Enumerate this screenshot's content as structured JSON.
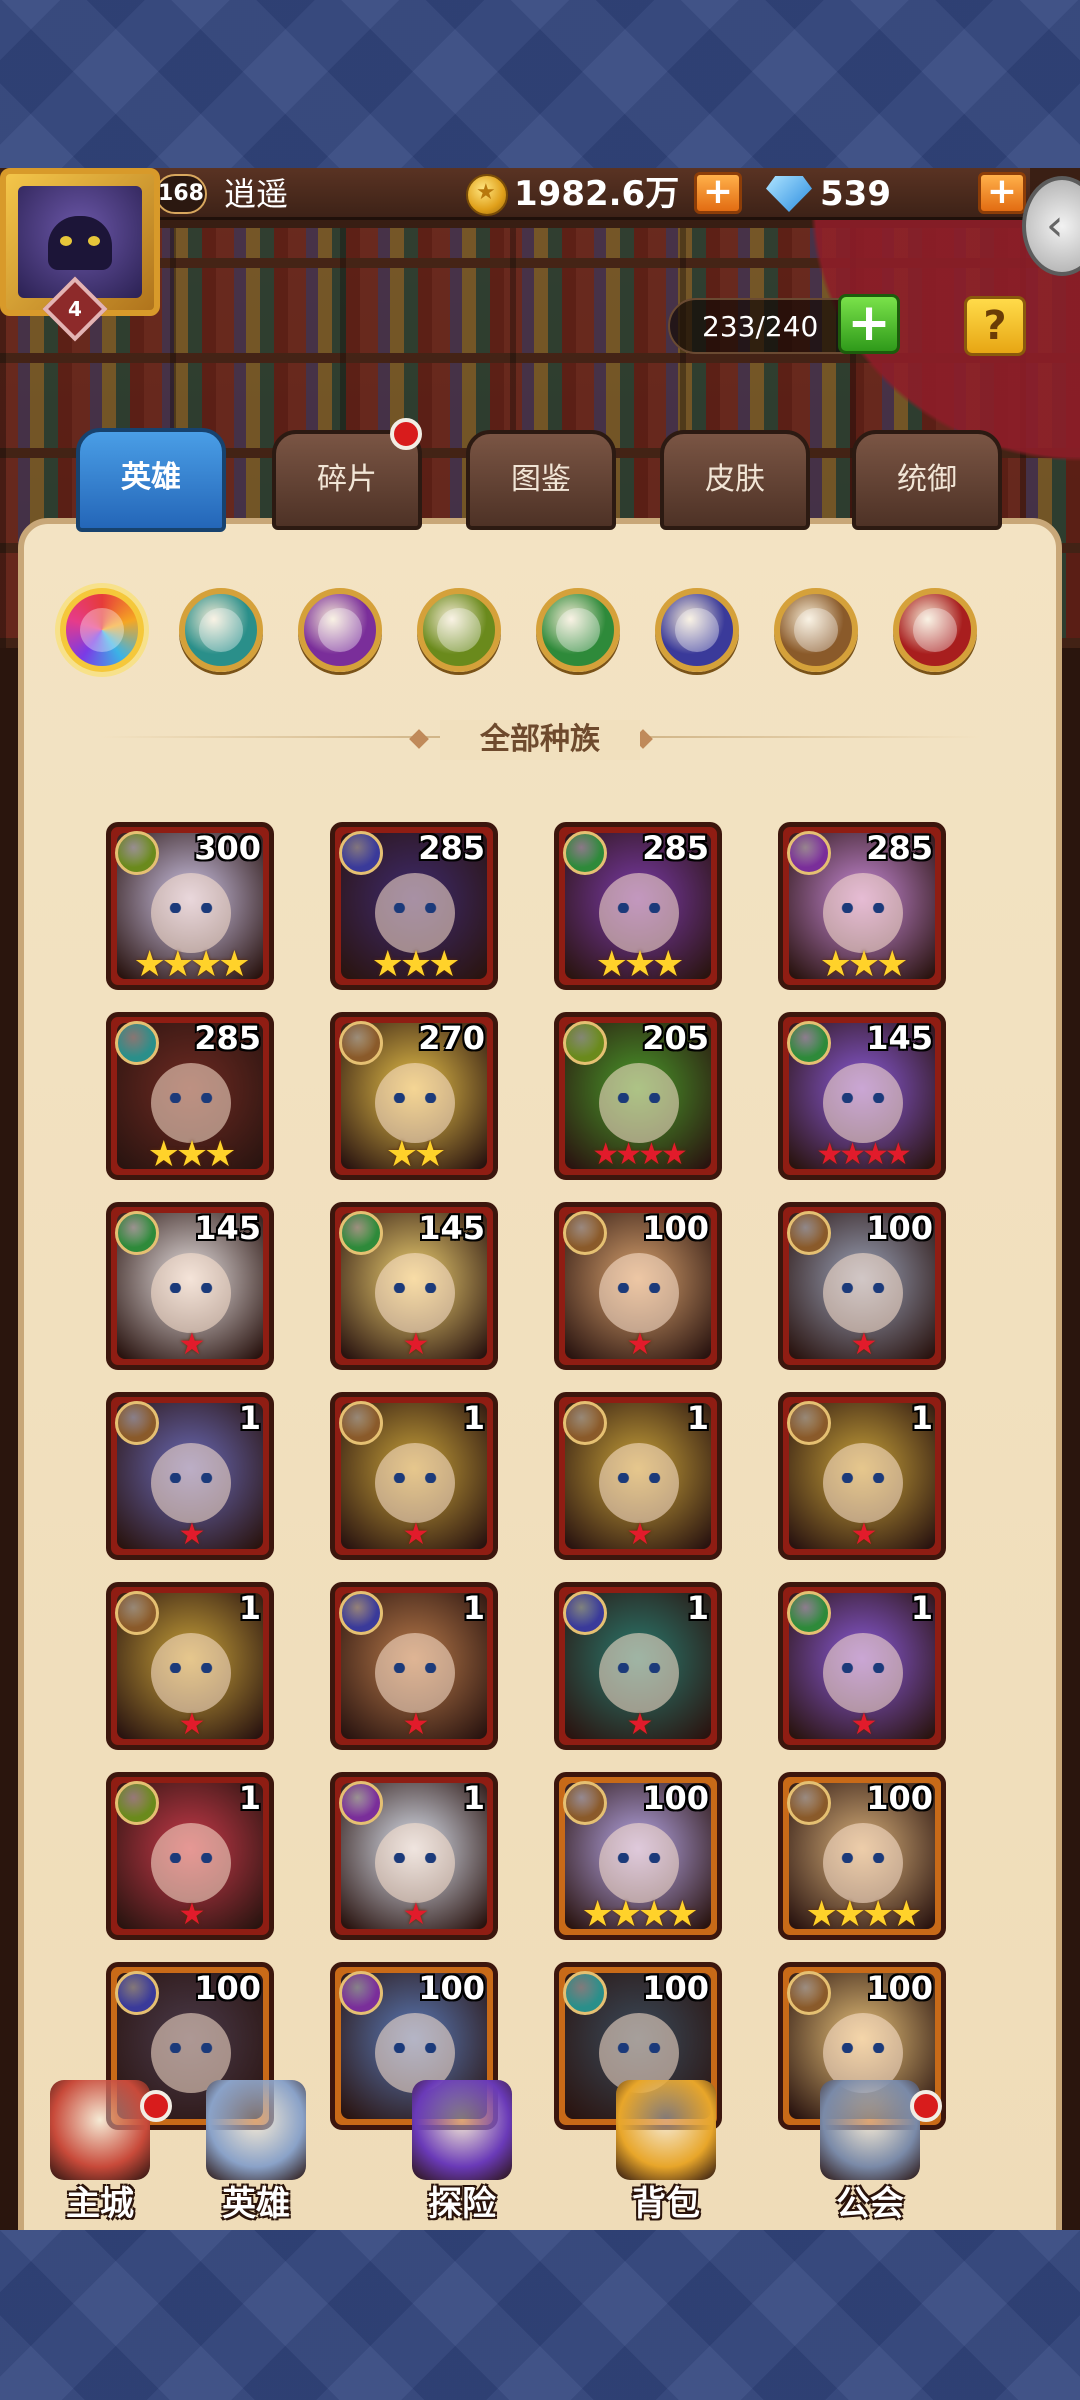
{
  "top_bar": {
    "vip_level": "4",
    "player_level": "168",
    "player_name": "逍遥",
    "gold": "1982.6万",
    "gems": "539",
    "hero_capacity": "233/240"
  },
  "tabs": [
    {
      "label": "英雄",
      "active": true
    },
    {
      "label": "碎片",
      "active": false,
      "badge": true
    },
    {
      "label": "图鉴",
      "active": false
    },
    {
      "label": "皮肤",
      "active": false
    },
    {
      "label": "统御",
      "active": false
    }
  ],
  "race_filters": [
    {
      "name": "all-races-icon",
      "color": "#e14f7a",
      "active": true
    },
    {
      "name": "race-teal-icon",
      "color": "#2a8f8a"
    },
    {
      "name": "race-purple-icon",
      "color": "#7a2e9a"
    },
    {
      "name": "race-olive-icon",
      "color": "#6a8a1c"
    },
    {
      "name": "race-green-icon",
      "color": "#2e8a3a"
    },
    {
      "name": "race-indigo-icon",
      "color": "#3a3a9a"
    },
    {
      "name": "race-light-icon",
      "color": "#8a5a2a"
    },
    {
      "name": "race-red-icon",
      "color": "#a81e1e"
    }
  ],
  "race_label": "全部种族",
  "heroes": [
    {
      "level": "300",
      "stars": "★★★★",
      "star_type": "gold",
      "race_color": "#6a8a1c",
      "art": "#cfc6e8"
    },
    {
      "level": "285",
      "stars": "★★★",
      "star_type": "gold",
      "race_color": "#3a3a9a",
      "art": "#3e2a6e"
    },
    {
      "level": "285",
      "stars": "★★★",
      "star_type": "gold",
      "race_color": "#2e8a3a",
      "art": "#7a3aa8"
    },
    {
      "level": "285",
      "stars": "★★★",
      "star_type": "gold",
      "race_color": "#7a2e9a",
      "art": "#c88ad8"
    },
    {
      "level": "285",
      "stars": "★★★",
      "star_type": "gold",
      "race_color": "#2a8f8a",
      "art": "#6e2a22"
    },
    {
      "level": "270",
      "stars": "★★",
      "star_type": "gold",
      "race_color": "#8a5a2a",
      "art": "#e8c24a"
    },
    {
      "level": "205",
      "stars": "★★★★",
      "star_type": "red",
      "race_color": "#6a8a1c",
      "art": "#4a9a2a"
    },
    {
      "level": "145",
      "stars": "★★★★",
      "star_type": "red",
      "race_color": "#2e8a3a",
      "art": "#8a5ad8"
    },
    {
      "level": "145",
      "stars": "★",
      "star_type": "red",
      "race_color": "#2e8a3a",
      "art": "#e8e2e2"
    },
    {
      "level": "145",
      "stars": "★",
      "star_type": "red",
      "race_color": "#2e8a3a",
      "art": "#f0d272"
    },
    {
      "level": "100",
      "stars": "★",
      "star_type": "red",
      "race_color": "#8a5a2a",
      "art": "#d8a26e"
    },
    {
      "level": "100",
      "stars": "★",
      "star_type": "red",
      "race_color": "#8a5a2a",
      "art": "#9aa2b8"
    },
    {
      "level": "1",
      "stars": "★",
      "star_type": "red",
      "race_color": "#8a5a2a",
      "art": "#6a6ab8"
    },
    {
      "level": "1",
      "stars": "★",
      "star_type": "red",
      "race_color": "#8a5a2a",
      "art": "#c8a23a"
    },
    {
      "level": "1",
      "stars": "★",
      "star_type": "red",
      "race_color": "#8a5a2a",
      "art": "#c8a23a"
    },
    {
      "level": "1",
      "stars": "★",
      "star_type": "red",
      "race_color": "#8a5a2a",
      "art": "#c8a23a"
    },
    {
      "level": "1",
      "stars": "★",
      "star_type": "red",
      "race_color": "#8a5a2a",
      "art": "#c8a23a"
    },
    {
      "level": "1",
      "stars": "★",
      "star_type": "red",
      "race_color": "#3a3a9a",
      "art": "#b87a4a"
    },
    {
      "level": "1",
      "stars": "★",
      "star_type": "red",
      "race_color": "#3a3a9a",
      "art": "#2a7a6e"
    },
    {
      "level": "1",
      "stars": "★",
      "star_type": "red",
      "race_color": "#2e8a3a",
      "art": "#8a5ad8"
    },
    {
      "level": "1",
      "stars": "★",
      "star_type": "red",
      "race_color": "#6a8a1c",
      "art": "#c83a4a"
    },
    {
      "level": "1",
      "stars": "★",
      "star_type": "red",
      "race_color": "#7a2e9a",
      "art": "#dde4f0"
    },
    {
      "level": "100",
      "stars": "★★★★",
      "star_type": "gold",
      "race_color": "#8a5a2a",
      "art": "#b8a8e8",
      "frame": "orange"
    },
    {
      "level": "100",
      "stars": "★★★★",
      "star_type": "gold",
      "race_color": "#8a5a2a",
      "art": "#d8b07a",
      "frame": "orange"
    },
    {
      "level": "100",
      "stars": "",
      "star_type": "gold",
      "race_color": "#3a3a9a",
      "art": "#4a3a4a",
      "frame": "orange"
    },
    {
      "level": "100",
      "stars": "",
      "star_type": "gold",
      "race_color": "#7a2e9a",
      "art": "#5a7ab8",
      "frame": "orange"
    },
    {
      "level": "100",
      "stars": "",
      "star_type": "gold",
      "race_color": "#2a8f8a",
      "art": "#3a4a5a",
      "frame": "orange"
    },
    {
      "level": "100",
      "stars": "",
      "star_type": "gold",
      "race_color": "#8a5a2a",
      "art": "#e8c27a",
      "frame": "orange"
    }
  ],
  "bottom_nav": [
    {
      "label": "主城",
      "icon": "castle-icon",
      "badge": true,
      "color": "#c84a3a"
    },
    {
      "label": "英雄",
      "icon": "hero-portrait-icon",
      "badge": false,
      "color": "#8aa2c8"
    },
    {
      "label": "探险",
      "icon": "portal-icon",
      "badge": false,
      "color": "#6a3ab8"
    },
    {
      "label": "背包",
      "icon": "backpack-icon",
      "badge": false,
      "color": "#e8a62a"
    },
    {
      "label": "公会",
      "icon": "guild-tower-icon",
      "badge": true,
      "color": "#7a8aa8"
    }
  ]
}
